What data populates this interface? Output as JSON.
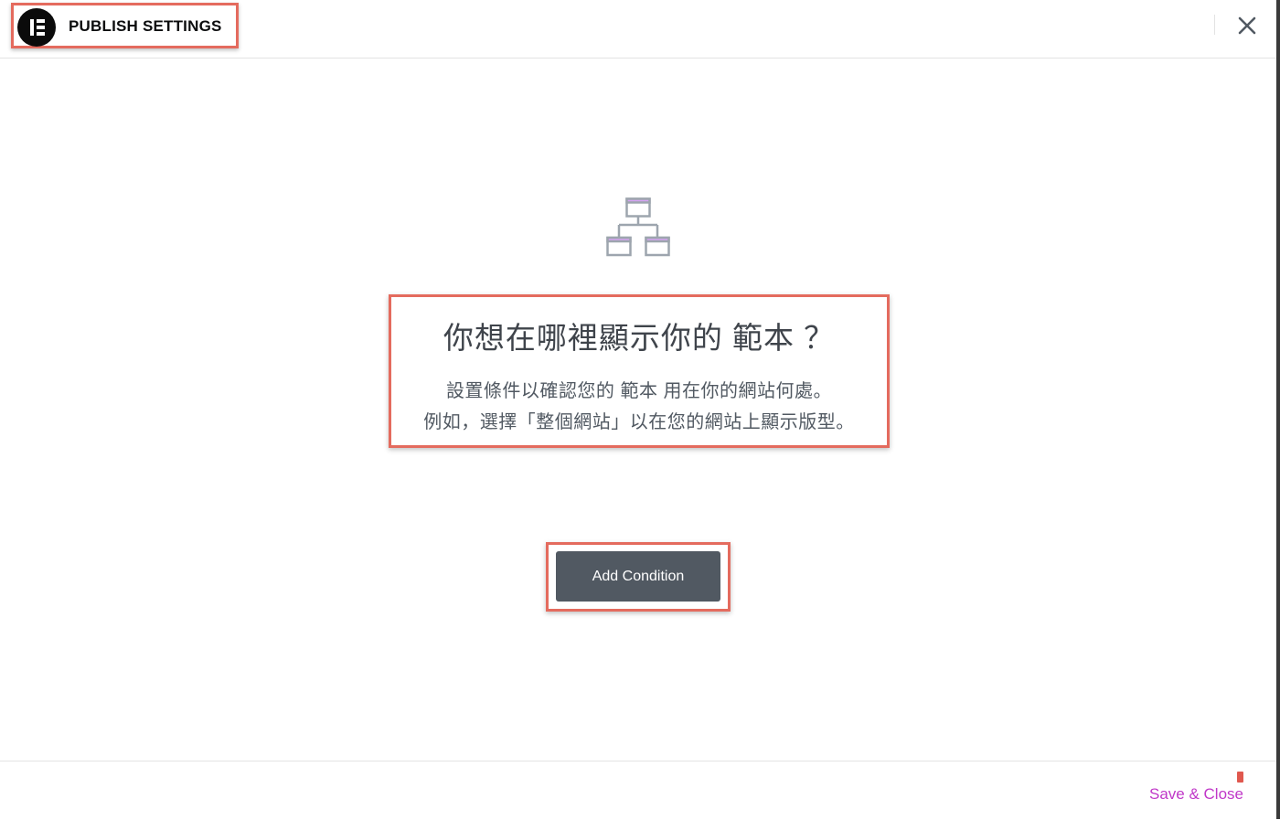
{
  "header": {
    "title": "PUBLISH SETTINGS",
    "logo_icon": "elementor-logo-icon",
    "close_icon": "close-icon"
  },
  "main": {
    "hero_icon": "sitemap-icon",
    "heading": "你想在哪裡顯示你的 範本 ？",
    "description_line1": "設置條件以確認您的 範本 用在你的網站何處。",
    "description_line2": "例如，選擇「整個網站」以在您的網站上顯示版型。",
    "add_condition_label": "Add Condition"
  },
  "footer": {
    "save_close_label": "Save & Close"
  },
  "colors": {
    "accent": "#c038c8",
    "button_bg": "#515962",
    "highlight_border": "#e46b5e",
    "icon_stroke": "#9da5ae",
    "icon_accent": "#d5a4f2"
  }
}
